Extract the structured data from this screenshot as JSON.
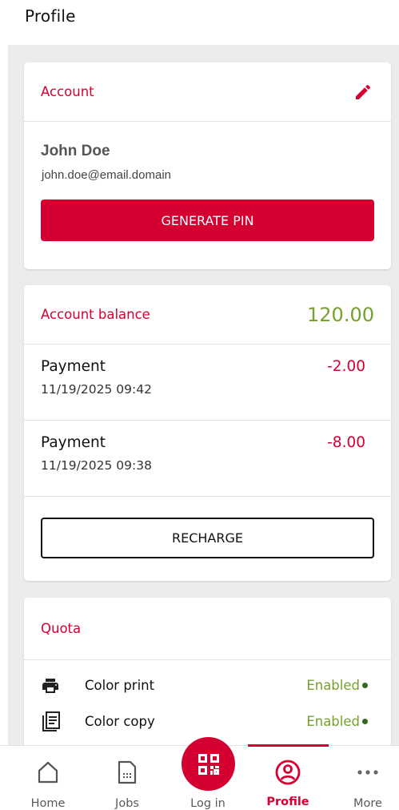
{
  "header": {
    "title": "Profile"
  },
  "account": {
    "title": "Account",
    "name": "John Doe",
    "email": "john.doe@email.domain",
    "generate_pin_label": "GENERATE PIN"
  },
  "balance": {
    "title": "Account balance",
    "amount": "120.00",
    "transactions": [
      {
        "label": "Payment",
        "amount": "-2.00",
        "datetime": "11/19/2025 09:42"
      },
      {
        "label": "Payment",
        "amount": "-8.00",
        "datetime": "11/19/2025 09:38"
      }
    ],
    "recharge_label": "RECHARGE"
  },
  "quota": {
    "title": "Quota",
    "items": [
      {
        "label": "Color print",
        "status": "Enabled",
        "icon": "printer-icon"
      },
      {
        "label": "Color copy",
        "status": "Enabled",
        "icon": "copy-icon"
      }
    ]
  },
  "nav": {
    "items": [
      {
        "label": "Home",
        "icon": "home-icon"
      },
      {
        "label": "Jobs",
        "icon": "jobs-icon"
      },
      {
        "label": "Log in",
        "icon": "qr-code-icon"
      },
      {
        "label": "Profile",
        "icon": "profile-icon",
        "active": true
      },
      {
        "label": "More",
        "icon": "more-icon"
      }
    ]
  },
  "colors": {
    "accent": "#d50032",
    "positive": "#76a12e",
    "status_dot": "#33691e",
    "background": "#ececee"
  }
}
